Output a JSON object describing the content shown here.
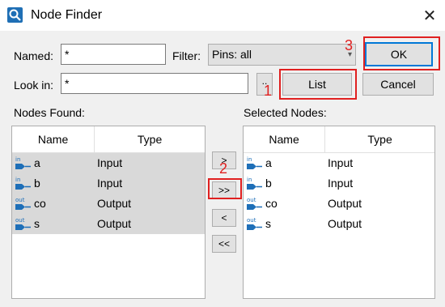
{
  "window": {
    "title": "Node Finder",
    "close_glyph": "✕",
    "icon": "node-finder-icon"
  },
  "named": {
    "label": "Named:",
    "value": "*"
  },
  "filter": {
    "label": "Filter:",
    "value": "Pins: all"
  },
  "lookin": {
    "label": "Look in:",
    "value": "*",
    "browse_label": ".."
  },
  "buttons": {
    "ok": "OK",
    "list": "List",
    "cancel": "Cancel"
  },
  "nodes_found": {
    "label": "Nodes Found:",
    "col_name": "Name",
    "col_type": "Type",
    "rows": [
      {
        "name": "a",
        "type": "Input",
        "dir": "in"
      },
      {
        "name": "b",
        "type": "Input",
        "dir": "in"
      },
      {
        "name": "co",
        "type": "Output",
        "dir": "out"
      },
      {
        "name": "s",
        "type": "Output",
        "dir": "out"
      }
    ]
  },
  "selected_nodes": {
    "label": "Selected Nodes:",
    "col_name": "Name",
    "col_type": "Type",
    "rows": [
      {
        "name": "a",
        "type": "Input",
        "dir": "in"
      },
      {
        "name": "b",
        "type": "Input",
        "dir": "in"
      },
      {
        "name": "co",
        "type": "Output",
        "dir": "out"
      },
      {
        "name": "s",
        "type": "Output",
        "dir": "out"
      }
    ]
  },
  "transfer": {
    "add_one": ">",
    "add_all": ">>",
    "remove_one": "<",
    "remove_all": "<<"
  },
  "annotations": {
    "step1": "1",
    "step2": "2",
    "step3": "3"
  },
  "colors": {
    "highlight": "#e02020",
    "pin_icon": "#1e6fb8",
    "selection": "#d9d9d9"
  }
}
